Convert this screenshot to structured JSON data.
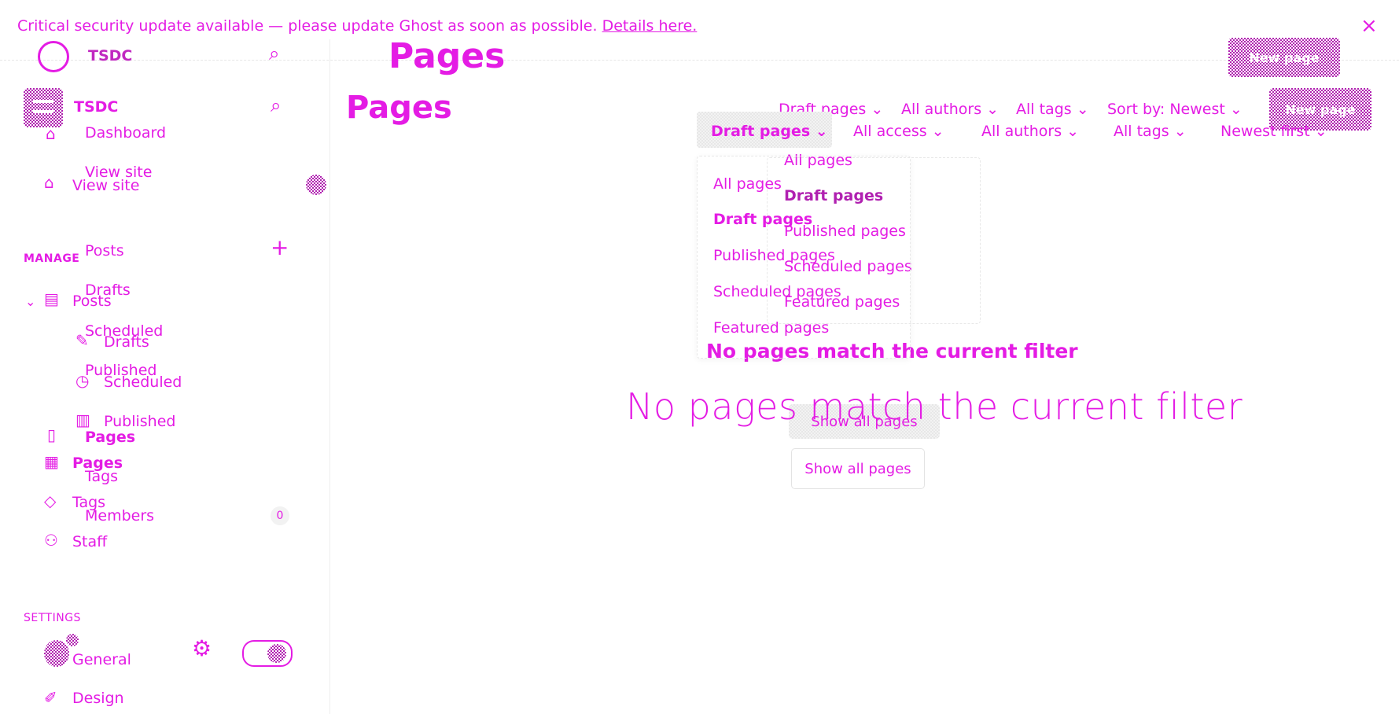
{
  "banner": {
    "message": "Critical security update available — please update Ghost as soon as possible.",
    "link": "Details here."
  },
  "site": {
    "name": "TSDC"
  },
  "ghost_layer": {
    "title": "Pages",
    "new_button": "New page",
    "filters": [
      "Draft pages",
      "All authors",
      "All tags",
      "Sort by: Newest"
    ],
    "dropdown": [
      "All pages",
      "Draft pages",
      "Published pages",
      "Scheduled pages",
      "Featured pages"
    ],
    "empty_title": "No pages match the current filter",
    "show_all": "Show all pages",
    "nav": [
      "Dashboard",
      "View site",
      "Posts",
      "Drafts",
      "Scheduled",
      "Published",
      "Pages",
      "Tags",
      "Members"
    ],
    "members_count": "0"
  },
  "sidebar": {
    "view_site": "View site",
    "manage_heading": "MANAGE",
    "posts": "Posts",
    "drafts": "Drafts",
    "scheduled": "Scheduled",
    "published": "Published",
    "pages": "Pages",
    "tags": "Tags",
    "staff": "Staff",
    "settings_heading": "SETTINGS",
    "general": "General",
    "design": "Design"
  },
  "main": {
    "title": "Pages",
    "new_button": "New page",
    "filters": [
      "Draft pages",
      "All access",
      "All authors",
      "All tags",
      "Newest first"
    ],
    "dropdown": [
      "All pages",
      "Draft pages",
      "Published pages",
      "Scheduled pages",
      "Featured pages"
    ],
    "empty_title": "No pages match the current filter",
    "show_all": "Show all pages"
  },
  "icons": {
    "close": "close-icon",
    "search": "search-icon",
    "home": "home-icon",
    "globe": "globe-icon",
    "plus": "plus-icon",
    "gear": "gear-icon",
    "chevron": "chevron-down-icon"
  },
  "colors": {
    "accent": "#e41ce4",
    "accent_dark": "#b020b0"
  }
}
